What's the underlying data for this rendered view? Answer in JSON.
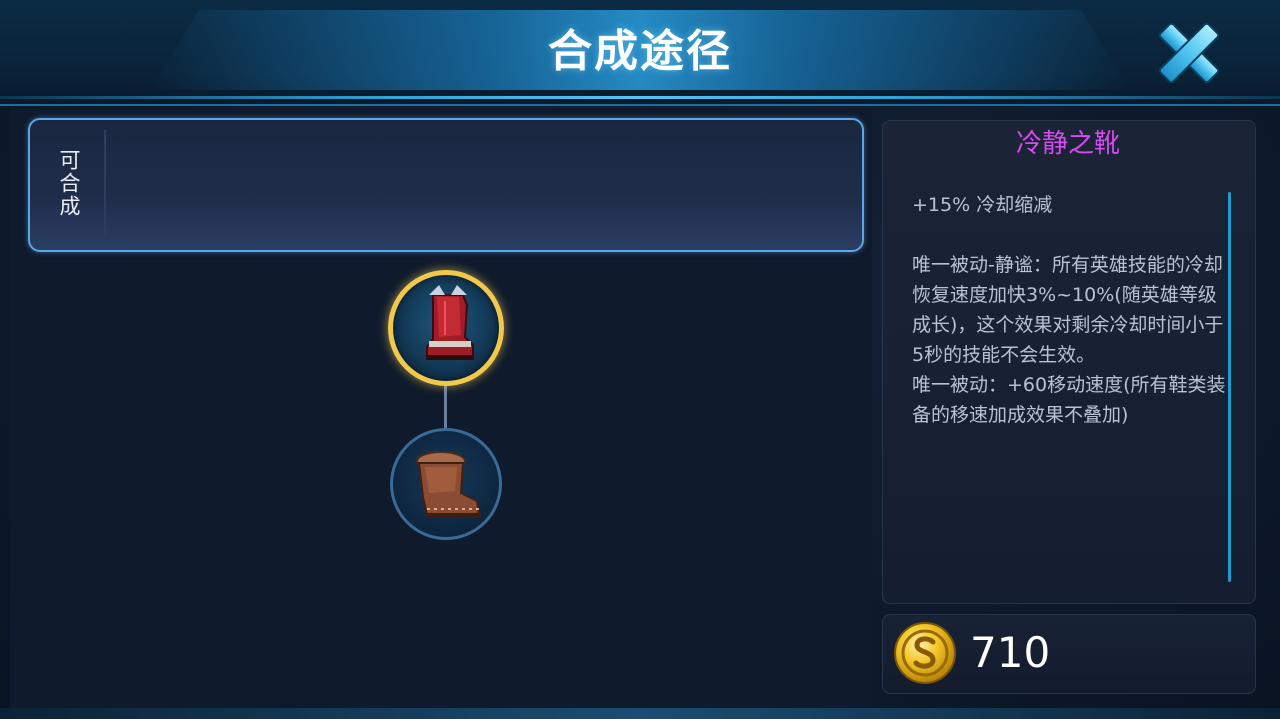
{
  "header": {
    "title": "合成途径"
  },
  "craft_section": {
    "label": "可合成"
  },
  "recipe_tree": {
    "main_item_icon": "red-armored-boot-icon",
    "component_icon": "brown-leather-boot-icon"
  },
  "detail": {
    "item_name": "冷静之靴",
    "item_name_color": "#d64bf0",
    "description": "+15% 冷却缩减\n\n唯一被动-静谧：所有英雄技能的冷却恢复速度加快3%~10%(随英雄等级成长)，这个效果对剩余冷却时间小于5秒的技能不会生效。\n唯一被动：+60移动速度(所有鞋类装备的移速加成效果不叠加)"
  },
  "price": {
    "icon": "gold-coin-icon",
    "value": "710"
  },
  "colors": {
    "accent_blue": "#2fa3d8",
    "selected_ring": "#f2c84a"
  }
}
